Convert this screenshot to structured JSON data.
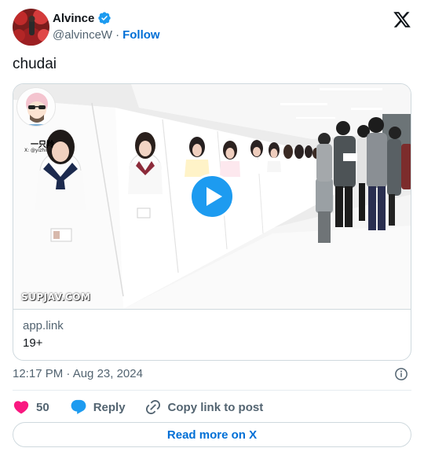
{
  "author": {
    "display_name": "Alvince",
    "handle": "@alvinceW",
    "separator": "·",
    "follow_label": "Follow"
  },
  "tweet": {
    "text": "chudai",
    "timestamp": "12:17 PM · Aug 23, 2024"
  },
  "card": {
    "domain": "app.link",
    "title": "19+",
    "watermark": "SUPJAV.COM",
    "inset_name": "一只羚",
    "inset_handle": "X: @yizhi..."
  },
  "actions": {
    "like_count": "50",
    "reply_label": "Reply",
    "copy_label": "Copy link to post"
  },
  "read_more_label": "Read more on X",
  "colors": {
    "link_blue": "#006fd6",
    "verified_blue": "#1d9bf0",
    "like_pink": "#f91880",
    "muted_gray": "#536471"
  },
  "icons": [
    "verified-badge-icon",
    "x-logo-icon",
    "play-icon",
    "info-icon",
    "heart-icon",
    "speech-bubble-icon",
    "link-icon"
  ]
}
